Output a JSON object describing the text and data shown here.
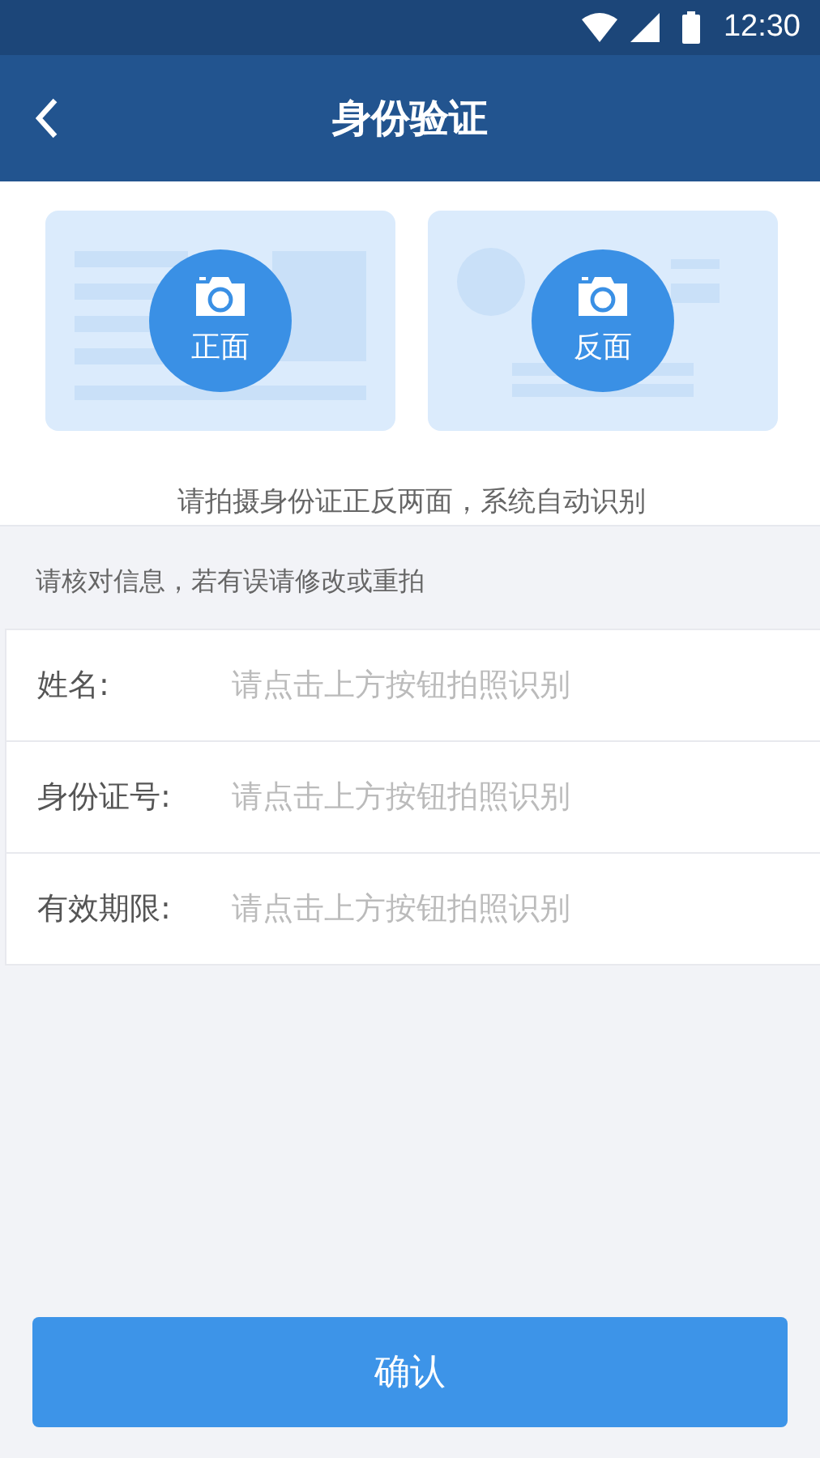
{
  "status_bar": {
    "time": "12:30"
  },
  "nav": {
    "title": "身份验证"
  },
  "id_cards": [
    {
      "kind": "front",
      "label": "正面"
    },
    {
      "kind": "back",
      "label": "反面"
    }
  ],
  "capture_hint": "请拍摄身份证正反两面，系统自动识别",
  "section_label": "请核对信息，若有误请修改或重拍",
  "fields": [
    {
      "label": "姓名:",
      "placeholder": "请点击上方按钮拍照识别"
    },
    {
      "label": "身份证号:",
      "placeholder": "请点击上方按钮拍照识别"
    },
    {
      "label": "有效期限:",
      "placeholder": "请点击上方按钮拍照识别"
    }
  ],
  "confirm_button": "确认"
}
